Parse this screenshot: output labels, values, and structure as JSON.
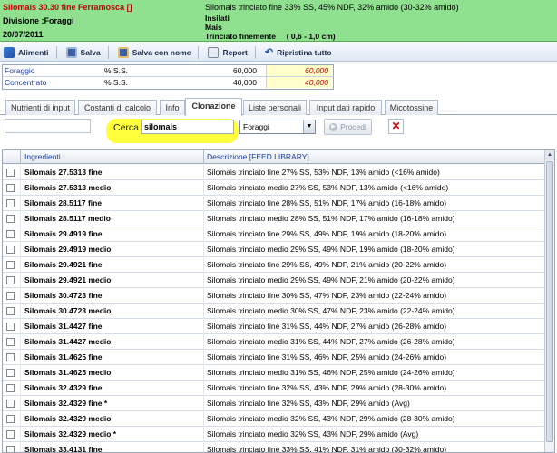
{
  "header": {
    "title": "Silomais 30.30 fine Ferramosca []",
    "division": "Divisione :Foraggi",
    "date": "20/07/2011",
    "description": "Silomais trinciato fine 33% SS, 45% NDF, 32% amido (30-32% amido)",
    "class1": "Insilati",
    "class2": "Mais",
    "class3": "Trinciato finemente     ( 0,6 - 1,0 cm)"
  },
  "toolbar": {
    "alimenti": "Alimenti",
    "salva": "Salva",
    "salva_nome": "Salva con nome",
    "report": "Report",
    "ripristina": "Ripristina tutto"
  },
  "ratio": {
    "rows": [
      {
        "label": "Foraggio",
        "unit": "% S.S.",
        "value": "60,000",
        "value2": "60,000"
      },
      {
        "label": "Concentrato",
        "unit": "% S.S.",
        "value": "40,000",
        "value2": "40,000"
      }
    ]
  },
  "tabs": [
    {
      "label": "Nutrienti di input",
      "active": false
    },
    {
      "label": "Costanti di calcolo",
      "active": false
    },
    {
      "label": "Info",
      "active": false
    },
    {
      "label": "Clonazione",
      "active": true
    },
    {
      "label": "Liste personali",
      "active": false
    },
    {
      "label": "Input dati rapido",
      "active": false
    },
    {
      "label": "Micotossine",
      "active": false
    }
  ],
  "search": {
    "label": "Cerca",
    "value": "silomais",
    "category": "Foraggi",
    "proceed": "Procedi"
  },
  "grid": {
    "col_ingredients": "Ingredienti",
    "col_description": "Descrizione  [FEED LIBRARY]",
    "rows": [
      {
        "name": "Silomais 27.5313 fine",
        "desc": "Silomais trinciato fine 27% SS, 53% NDF, 13% amido (<16% amido)"
      },
      {
        "name": "Silomais 27.5313 medio",
        "desc": "Silomais trinciato medio 27% SS, 53% NDF, 13% amido (<16% amido)"
      },
      {
        "name": "Silomais 28.5117 fine",
        "desc": "Silomais trinciato fine 28% SS, 51% NDF, 17% amido (16-18% amido)"
      },
      {
        "name": "Silomais 28.5117 medio",
        "desc": "Silomais trinciato medio 28% SS, 51% NDF, 17% amido (16-18% amido)"
      },
      {
        "name": "Silomais 29.4919 fine",
        "desc": "Silomais trinciato fine 29% SS, 49% NDF, 19% amido (18-20% amido)"
      },
      {
        "name": "Silomais 29.4919 medio",
        "desc": "Silomais trinciato medio 29% SS, 49% NDF, 19% amido (18-20% amido)"
      },
      {
        "name": "Silomais 29.4921 fine",
        "desc": "Silomais trinciato fine 29% SS, 49% NDF, 21% amido (20-22% amido)"
      },
      {
        "name": "Silomais 29.4921 medio",
        "desc": "Silomais trinciato medio 29% SS, 49% NDF, 21% amido (20-22% amido)"
      },
      {
        "name": "Silomais 30.4723 fine",
        "desc": "Silomais trinciato fine 30% SS, 47% NDF, 23% amido (22-24% amido)"
      },
      {
        "name": "Silomais 30.4723 medio",
        "desc": "Silomais trinciato medio 30% SS, 47% NDF, 23% amido (22-24% amido)"
      },
      {
        "name": "Silomais 31.4427 fine",
        "desc": "Silomais trinciato fine 31% SS, 44% NDF, 27% amido (26-28% amido)"
      },
      {
        "name": "Silomais 31.4427 medio",
        "desc": "Silomais trinciato medio 31% SS, 44% NDF, 27% amido (26-28% amido)"
      },
      {
        "name": "Silomais 31.4625 fine",
        "desc": "Silomais trinciato fine 31% SS, 46% NDF, 25% amido (24-26% amido)"
      },
      {
        "name": "Silomais 31.4625 medio",
        "desc": "Silomais trinciato medio 31% SS, 46% NDF, 25% amido (24-26% amido)"
      },
      {
        "name": "Silomais 32.4329 fine",
        "desc": "Silomais trinciato fine 32% SS, 43% NDF, 29% amido (28-30% amido)"
      },
      {
        "name": "Silomais 32.4329 fine *",
        "desc": "Silomais trinciato fine 32% SS, 43% NDF, 29% amido (Avg)"
      },
      {
        "name": "Silomais 32.4329 medio",
        "desc": "Silomais trinciato medio 32% SS, 43% NDF, 29% amido (28-30% amido)"
      },
      {
        "name": "Silomais 32.4329 medio *",
        "desc": "Silomais trinciato medio 32% SS, 43% NDF, 29% amido (Avg)"
      },
      {
        "name": "Silomais 33.4131 fine",
        "desc": "Silomais trinciato fine 33% SS, 41% NDF, 31% amido (30-32% amido)"
      }
    ]
  },
  "icons": {
    "alimenti": "cards-icon",
    "salva": "floppy-icon",
    "salva_nome": "floppy-edit-icon",
    "report": "printer-icon",
    "ripristina": "undo-icon",
    "proceed": "play-icon",
    "clear": "close-icon"
  },
  "colors": {
    "header_bg": "#8fe08f",
    "title_red": "#c00000",
    "highlight": "#ffff33",
    "link_blue": "#1b3d9e"
  }
}
